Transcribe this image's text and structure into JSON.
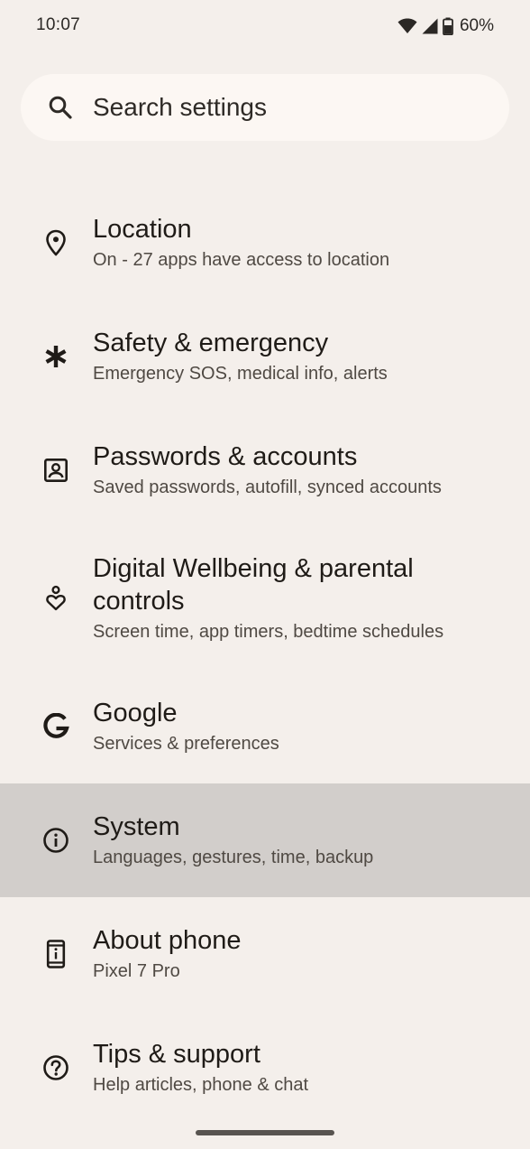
{
  "status_bar": {
    "time": "10:07",
    "battery": "60%",
    "icons": [
      "wifi-icon",
      "cellular-signal-icon",
      "battery-icon"
    ]
  },
  "search": {
    "placeholder": "Search settings"
  },
  "settings": [
    {
      "title": "Location",
      "summary": "On - 27 apps have access to location",
      "icon": "location-pin-icon"
    },
    {
      "title": "Safety & emergency",
      "summary": "Emergency SOS, medical info, alerts",
      "icon": "asterisk-icon"
    },
    {
      "title": "Passwords & accounts",
      "summary": "Saved passwords, autofill, synced accounts",
      "icon": "account-box-icon"
    },
    {
      "title": "Digital Wellbeing & parental controls",
      "summary": "Screen time, app timers, bedtime schedules",
      "icon": "wellbeing-icon"
    },
    {
      "title": "Google",
      "summary": "Services & preferences",
      "icon": "google-icon"
    },
    {
      "title": "System",
      "summary": "Languages, gestures, time, backup",
      "icon": "info-icon",
      "selected": true
    },
    {
      "title": "About phone",
      "summary": "Pixel 7 Pro",
      "icon": "phone-info-icon"
    },
    {
      "title": "Tips & support",
      "summary": "Help articles, phone & chat",
      "icon": "help-icon"
    }
  ],
  "colors": {
    "background": "#f4efeb",
    "search_bg": "#fcf7f3",
    "selected_row": "#d2cecb",
    "text_primary": "#1f1b17",
    "text_secondary": "#4f4943"
  }
}
